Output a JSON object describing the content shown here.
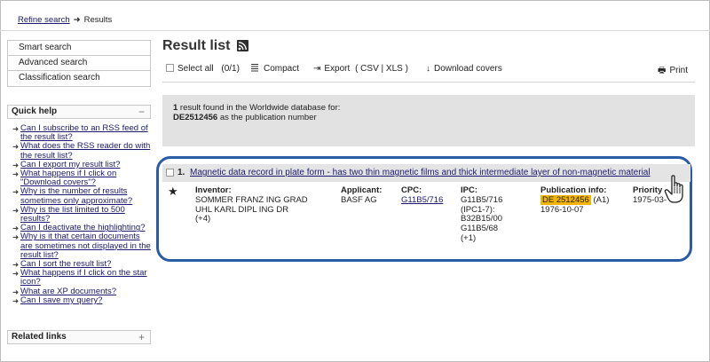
{
  "breadcrumb": {
    "refine_label": "Refine search",
    "arrow": "➜",
    "current": "Results"
  },
  "sidebar": {
    "search_items": [
      "Smart search",
      "Advanced search",
      "Classification search"
    ],
    "quick_help": {
      "title": "Quick help",
      "toggle": "−",
      "links": [
        "Can I subscribe to an RSS feed of the result list?",
        "What does the RSS reader do with the result list?",
        "Can I export my result list?",
        "What happens if I click on \"Download covers\"?",
        "Why is the number of results sometimes only approximate?",
        "Why is the list limited to 500 results?",
        "Can I deactivate the highlighting?",
        "Why is it that certain documents are sometimes not displayed in the result list?",
        "Can I sort the result list?",
        "What happens if I click on the star icon?",
        "What are XP documents?",
        "Can I save my query?"
      ]
    },
    "related_links": {
      "title": "Related links",
      "toggle": "+"
    }
  },
  "main": {
    "title": "Result list",
    "toolbar": {
      "select_all": "Select all",
      "select_count": "(0/1)",
      "compact": "Compact",
      "export": "Export",
      "export_formats": "( CSV | XLS )",
      "download_covers": "Download covers",
      "print": "Print"
    },
    "info": {
      "count": "1",
      "line1_rest": " result found in the Worldwide database for:",
      "query": "DE2512456",
      "line2_rest": " as the publication number"
    },
    "result": {
      "number": "1.",
      "title": "Magnetic data record in plate form - has two thin magnetic films and thick intermediate layer of non-magnetic material",
      "inventor_label": "Inventor:",
      "inventors": [
        "SOMMER FRANZ ING GRAD",
        "UHL KARL DIPL ING DR",
        "(+4)"
      ],
      "applicant_label": "Applicant:",
      "applicant": "BASF AG",
      "cpc_label": "CPC:",
      "cpc": "G11B5/716",
      "ipc_label": "IPC:",
      "ipc": [
        "G11B5/716",
        "(IPC1-7):",
        "B32B15/00",
        "G11B5/68",
        "(+1)"
      ],
      "pub_label": "Publication info:",
      "pub_number": "DE 2512456",
      "pub_kind": "(A1)",
      "pub_date": "1976-10-07",
      "priority_label": "Priority",
      "priority_date": "1975-03-"
    }
  },
  "colors": {
    "outline": "#2a5ca6",
    "highlight": "#f2b400",
    "link": "#1a1a6e"
  }
}
